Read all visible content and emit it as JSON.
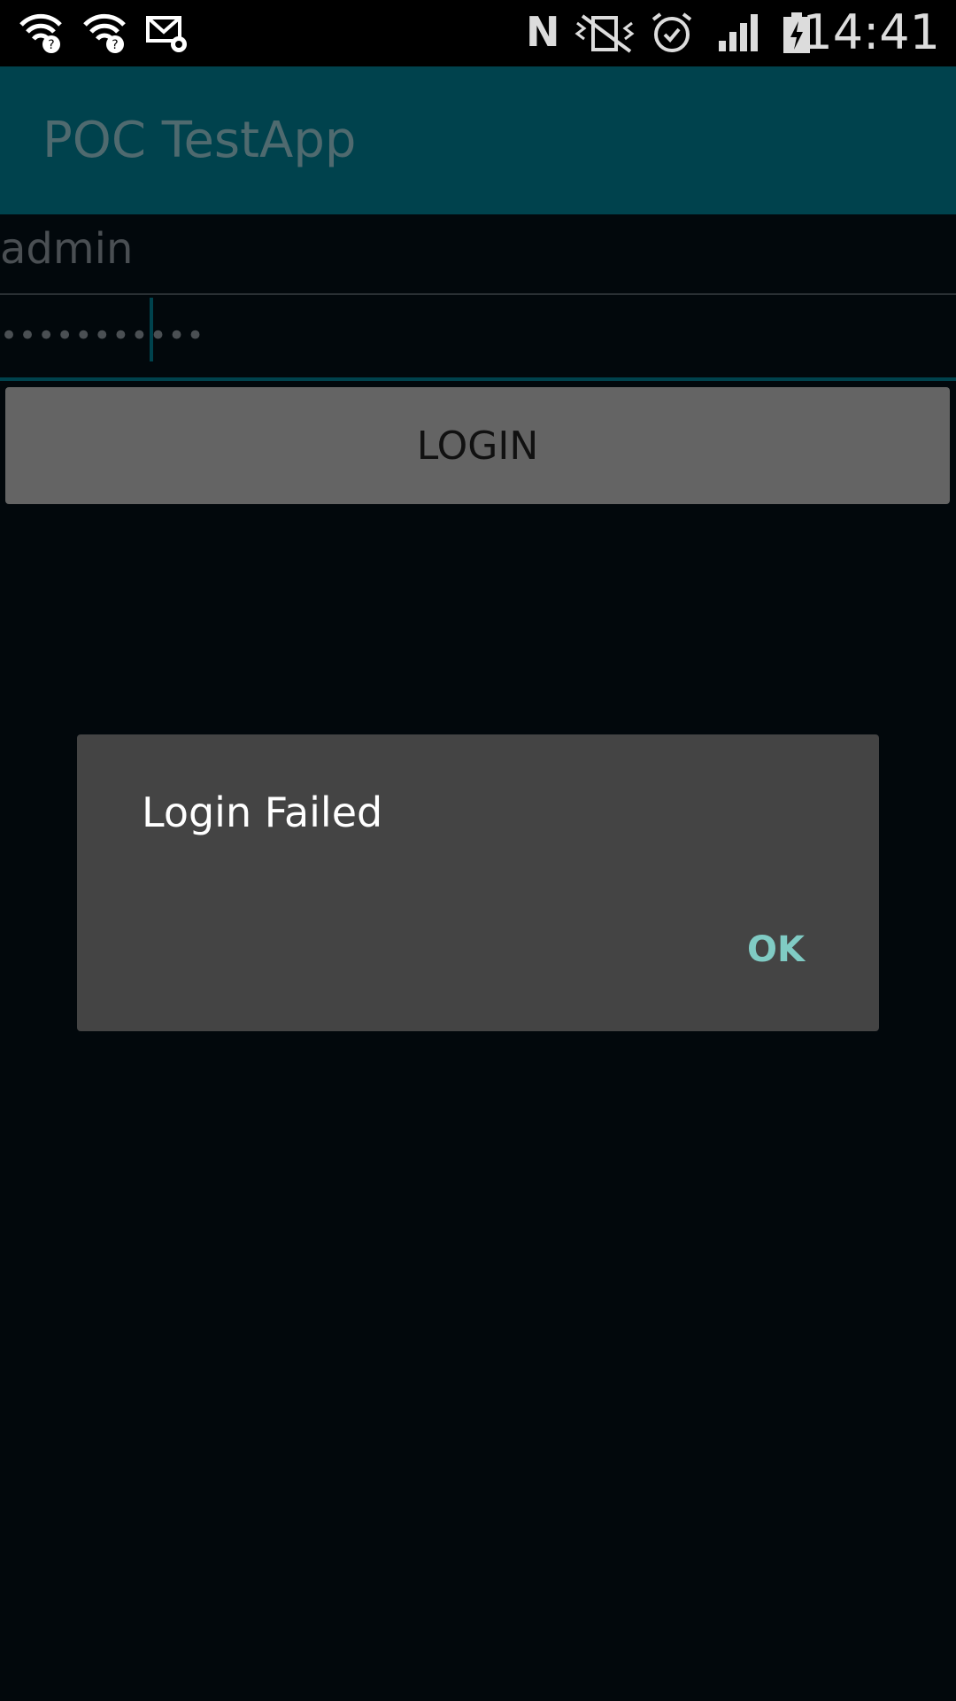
{
  "status_bar": {
    "time": "14:41",
    "icons": [
      "wifi-question-icon",
      "wifi-question-icon",
      "email-settings-icon",
      "nfc-icon",
      "vibrate-icon",
      "alarm-icon",
      "signal-icon",
      "battery-charging-icon"
    ]
  },
  "app_bar": {
    "title": "POC TestApp"
  },
  "form": {
    "username_value": "admin",
    "password_value": "•••••••••••",
    "login_label": "LOGIN"
  },
  "dialog": {
    "message": "Login Failed",
    "ok_label": "OK"
  },
  "colors": {
    "app_bar": "#00424d",
    "background": "#02080c",
    "dialog": "#444444",
    "accent": "#80cbc4"
  }
}
